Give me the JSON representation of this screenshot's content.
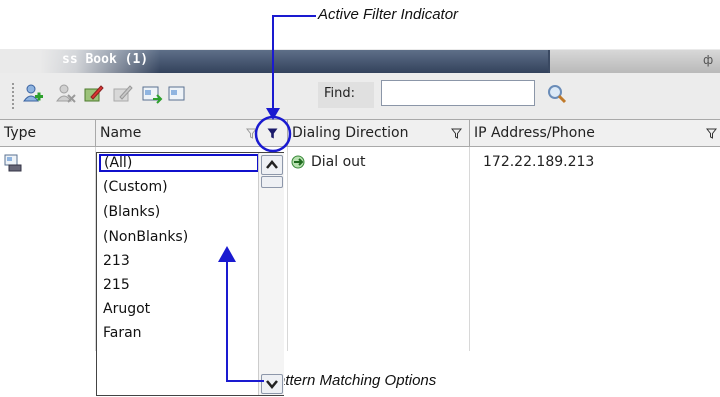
{
  "callouts": {
    "top": "Active Filter Indicator",
    "bottom": "Pattern Matching Options"
  },
  "window": {
    "title": "ss Book (1)",
    "pin_icon": "pin-icon"
  },
  "toolbar": {
    "icons": [
      "add-contact-icon",
      "delete-contact-icon",
      "edit-contact-icon",
      "delete-group-icon",
      "import-icon",
      "export-icon"
    ],
    "find_label": "Find:",
    "find_value": "",
    "search_icon": "magnifier-icon"
  },
  "columns": [
    {
      "label": "Type"
    },
    {
      "label": "Name"
    },
    {
      "label": "Dialing Direction"
    },
    {
      "label": "IP Address/Phone"
    }
  ],
  "rows": [
    {
      "type_icon": "endpoint-icon",
      "name": "",
      "direction": "Dial out",
      "address": "172.22.189.213"
    }
  ],
  "filter_dropdown": {
    "options": [
      "(All)",
      "(Custom)",
      "(Blanks)",
      "(NonBlanks)",
      "213",
      "215",
      "Arugot",
      "Faran"
    ],
    "selected": "(All)"
  },
  "colors": {
    "annotation": "#1a1ad0",
    "titlebar": "#33425c"
  }
}
